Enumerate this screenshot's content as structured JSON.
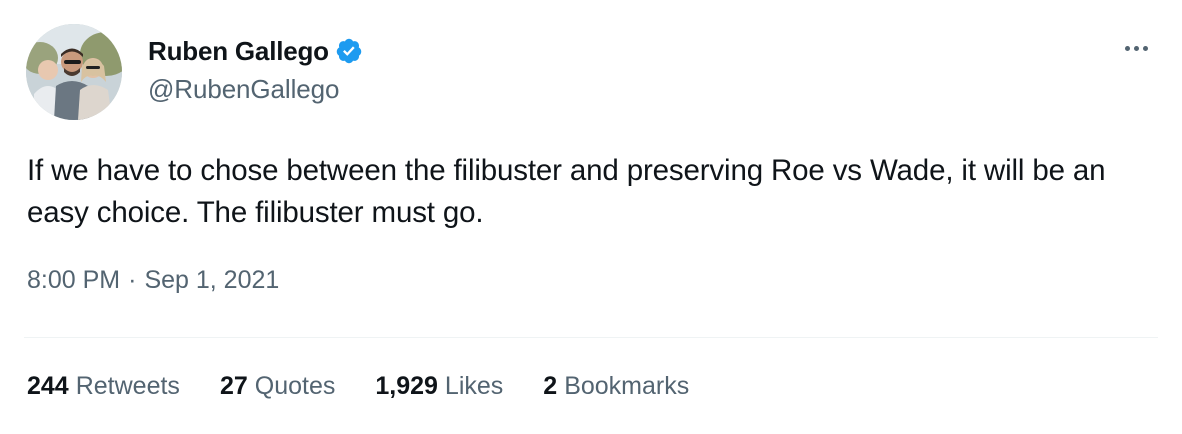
{
  "author": {
    "display_name": "Ruben Gallego",
    "handle": "@RubenGallego",
    "verified": true,
    "verified_color": "#1d9bf0",
    "avatar_icon": "profile-photo-icon"
  },
  "tweet": {
    "text": "If we have to chose between the filibuster and preserving Roe vs Wade, it will be an easy choice. The filibuster must go.",
    "time": "8:00 PM",
    "separator": "·",
    "date": "Sep 1, 2021"
  },
  "stats": [
    {
      "count": "244",
      "label": "Retweets"
    },
    {
      "count": "27",
      "label": "Quotes"
    },
    {
      "count": "1,929",
      "label": "Likes"
    },
    {
      "count": "2",
      "label": "Bookmarks"
    }
  ],
  "more_icon": "more-horizontal-icon",
  "colors": {
    "text_primary": "#0f1419",
    "text_secondary": "#536471",
    "divider": "#eff3f4",
    "background": "#ffffff"
  }
}
